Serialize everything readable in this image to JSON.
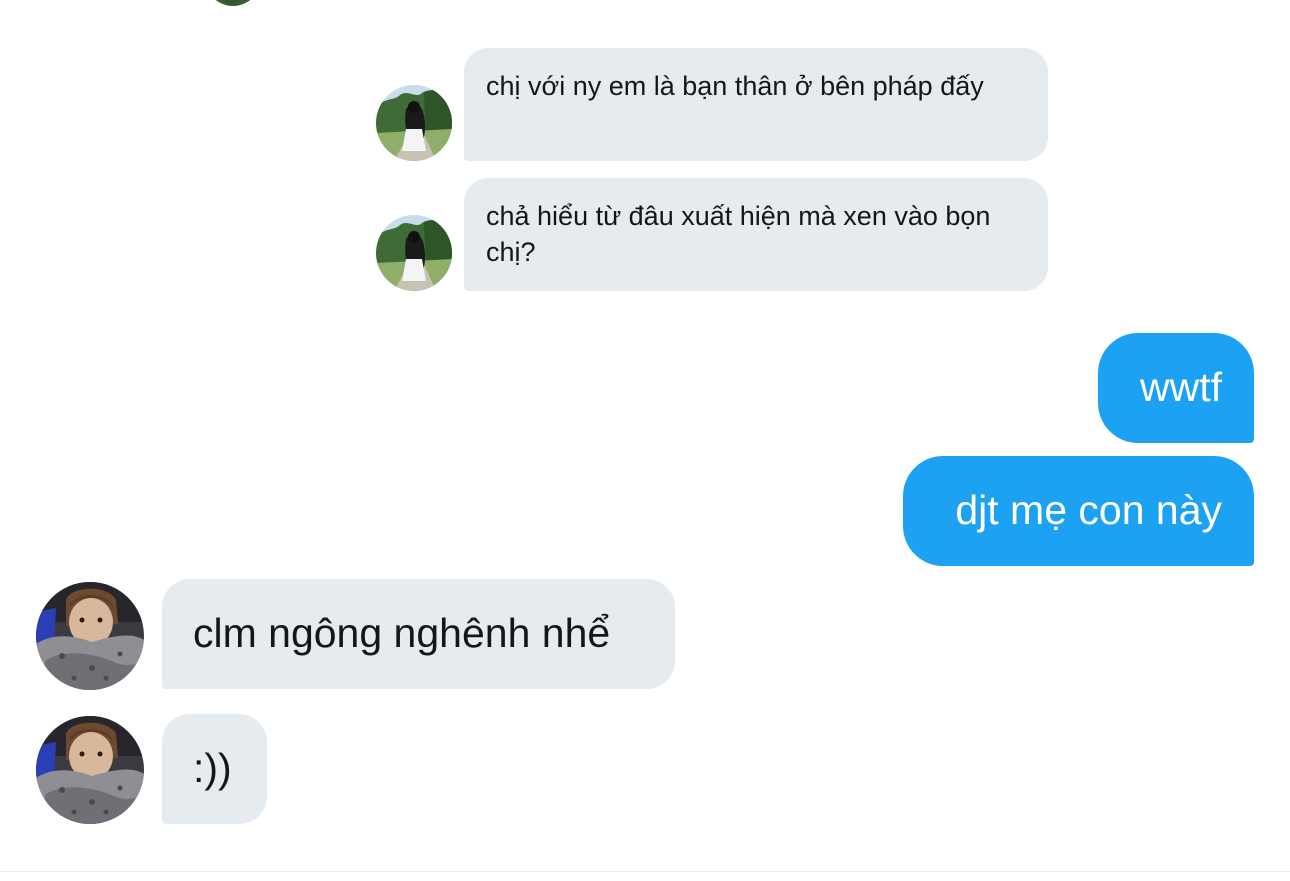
{
  "conversation": {
    "messages": [
      {
        "sender": "other",
        "text": "chị với ny em là bạn thân ở bên pháp đấy"
      },
      {
        "sender": "other",
        "text": "chả hiểu từ đâu xuất hiện mà xen vào bọn chị?"
      },
      {
        "sender": "me",
        "text": "wwtf"
      },
      {
        "sender": "me",
        "text": "djt mẹ con này"
      },
      {
        "sender": "other",
        "text": "clm ngông nghênh nhể"
      },
      {
        "sender": "other",
        "text": ":))"
      }
    ]
  },
  "colors": {
    "incoming_bubble": "#e6ebf0",
    "outgoing_bubble": "#1da1f2",
    "incoming_text": "#14171a",
    "outgoing_text": "#ffffff",
    "background": "#ffffff"
  },
  "icons": {
    "avatar_1": "avatar-girl-garden-photo",
    "avatar_2": "avatar-boy-selfie-photo"
  }
}
